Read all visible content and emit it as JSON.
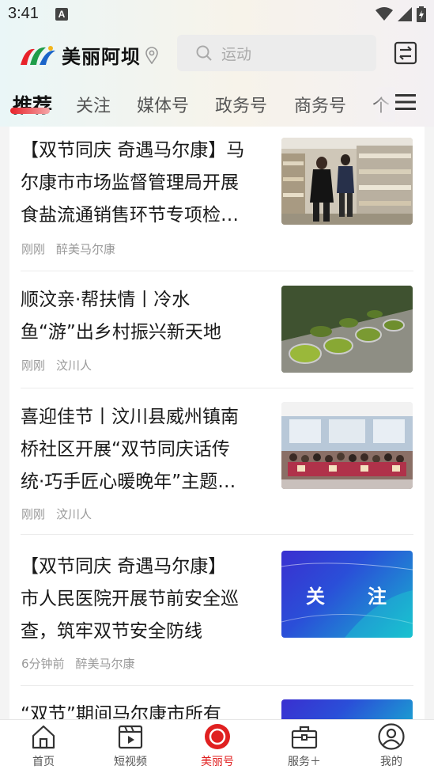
{
  "status": {
    "time": "3:41",
    "notification_badge": "A"
  },
  "header": {
    "logo_text": "美丽阿坝",
    "search_placeholder": "运动"
  },
  "tabs": [
    {
      "label": "推荐",
      "active": true
    },
    {
      "label": "关注"
    },
    {
      "label": "媒体号"
    },
    {
      "label": "政务号"
    },
    {
      "label": "商务号"
    },
    {
      "label": "个"
    }
  ],
  "feed": [
    {
      "title_lines": [
        "【双节同庆 奇遇马尔康】马",
        "尔康市市场监督管理局开展",
        "食盐流通销售环节专项检…"
      ],
      "time": "刚刚",
      "source": "醉美马尔康",
      "thumb": "supermarket-photo"
    },
    {
      "title_lines": [
        "顺汶亲·帮扶情丨冷水",
        "鱼“游”出乡村振兴新天地"
      ],
      "time": "刚刚",
      "source": "汶川人",
      "thumb": "fish-pond-photo"
    },
    {
      "title_lines": [
        "喜迎佳节丨汶川县威州镇南",
        "桥社区开展“双节同庆话传",
        "统·巧手匠心暖晚年”主题…"
      ],
      "time": "刚刚",
      "source": "汶川人",
      "thumb": "group-photo"
    },
    {
      "title_lines": [
        "【双节同庆 奇遇马尔康】",
        "市人民医院开展节前安全巡",
        "查，筑牢双节安全防线"
      ],
      "time": "6分钟前",
      "source": "醉美马尔康",
      "thumb": "follow-banner",
      "thumb_text": "关　　注"
    },
    {
      "title_lines": [
        "“双节”期间马尔康市所有"
      ],
      "thumb": "follow-banner-partial"
    }
  ],
  "bottom_nav": [
    {
      "label": "首页",
      "icon": "home-icon"
    },
    {
      "label": "短视频",
      "icon": "short-video-icon"
    },
    {
      "label": "美丽号",
      "icon": "meili-icon",
      "active": true
    },
    {
      "label": "服务＋",
      "icon": "briefcase-icon"
    },
    {
      "label": "我的",
      "icon": "profile-icon"
    }
  ],
  "colors": {
    "accent": "#e02020",
    "follow_banner_start": "#3a2fd0",
    "follow_banner_end": "#17b4cf"
  }
}
